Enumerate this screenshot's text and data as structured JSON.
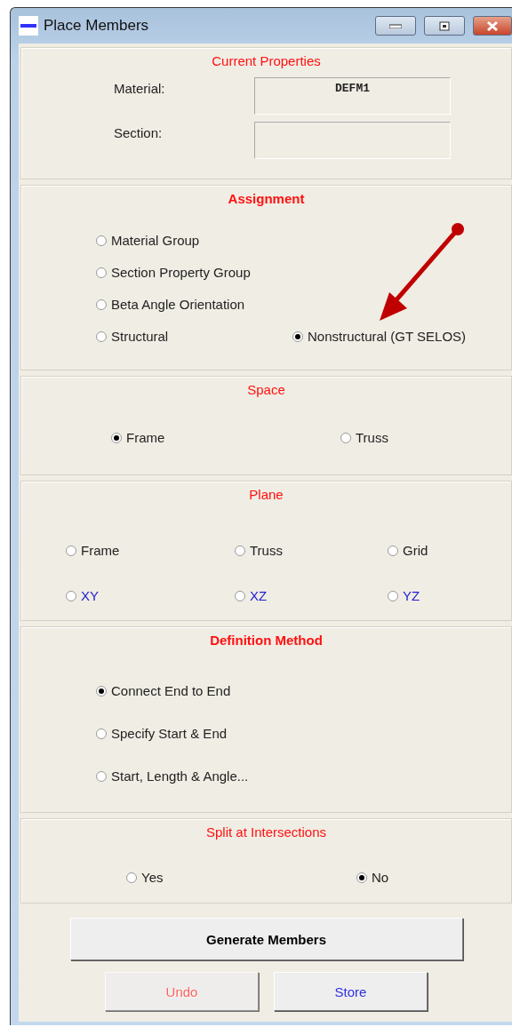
{
  "window": {
    "title": "Place Members"
  },
  "current_properties": {
    "heading": "Current Properties",
    "fields": [
      {
        "label": "Material:",
        "value": "DEFM1"
      },
      {
        "label": "Section:"
      }
    ]
  },
  "assignment": {
    "heading": "Assignment",
    "rows": [
      [
        {
          "label": "Material Group",
          "selected": false
        }
      ],
      [
        {
          "label": "Section Property Group",
          "selected": false
        }
      ],
      [
        {
          "label": "Beta Angle Orientation",
          "selected": false
        }
      ],
      [
        {
          "label": "Structural",
          "selected": false
        },
        {
          "label": "Nonstructural (GT SELOS)",
          "selected": true
        }
      ]
    ]
  },
  "space": {
    "heading": "Space",
    "options": [
      {
        "label": "Frame",
        "selected": true
      },
      {
        "label": "Truss",
        "selected": false
      }
    ]
  },
  "plane": {
    "heading": "Plane",
    "rows": [
      [
        {
          "label": "Frame",
          "selected": false,
          "kind": "type"
        },
        {
          "label": "Truss",
          "selected": false,
          "kind": "type"
        },
        {
          "label": "Grid",
          "selected": false,
          "kind": "type"
        }
      ],
      [
        {
          "label": "XY",
          "selected": false,
          "kind": "axis"
        },
        {
          "label": "XZ",
          "selected": false,
          "kind": "axis"
        },
        {
          "label": "YZ",
          "selected": false,
          "kind": "axis"
        }
      ]
    ]
  },
  "definition_method": {
    "heading": "Definition Method",
    "options": [
      {
        "label": "Connect End to End",
        "selected": true
      },
      {
        "label": "Specify Start & End",
        "selected": false
      },
      {
        "label": "Start, Length & Angle...",
        "selected": false
      }
    ]
  },
  "split": {
    "heading": "Split at Intersections",
    "options": [
      {
        "label": "Yes",
        "selected": false
      },
      {
        "label": "No",
        "selected": true
      }
    ]
  },
  "buttons": [
    {
      "label": "Generate Members",
      "kind": "primary",
      "disabled": false
    },
    {
      "label": "Undo",
      "kind": "secondary",
      "disabled": true
    },
    {
      "label": "Store",
      "kind": "secondary",
      "disabled": false
    }
  ]
}
